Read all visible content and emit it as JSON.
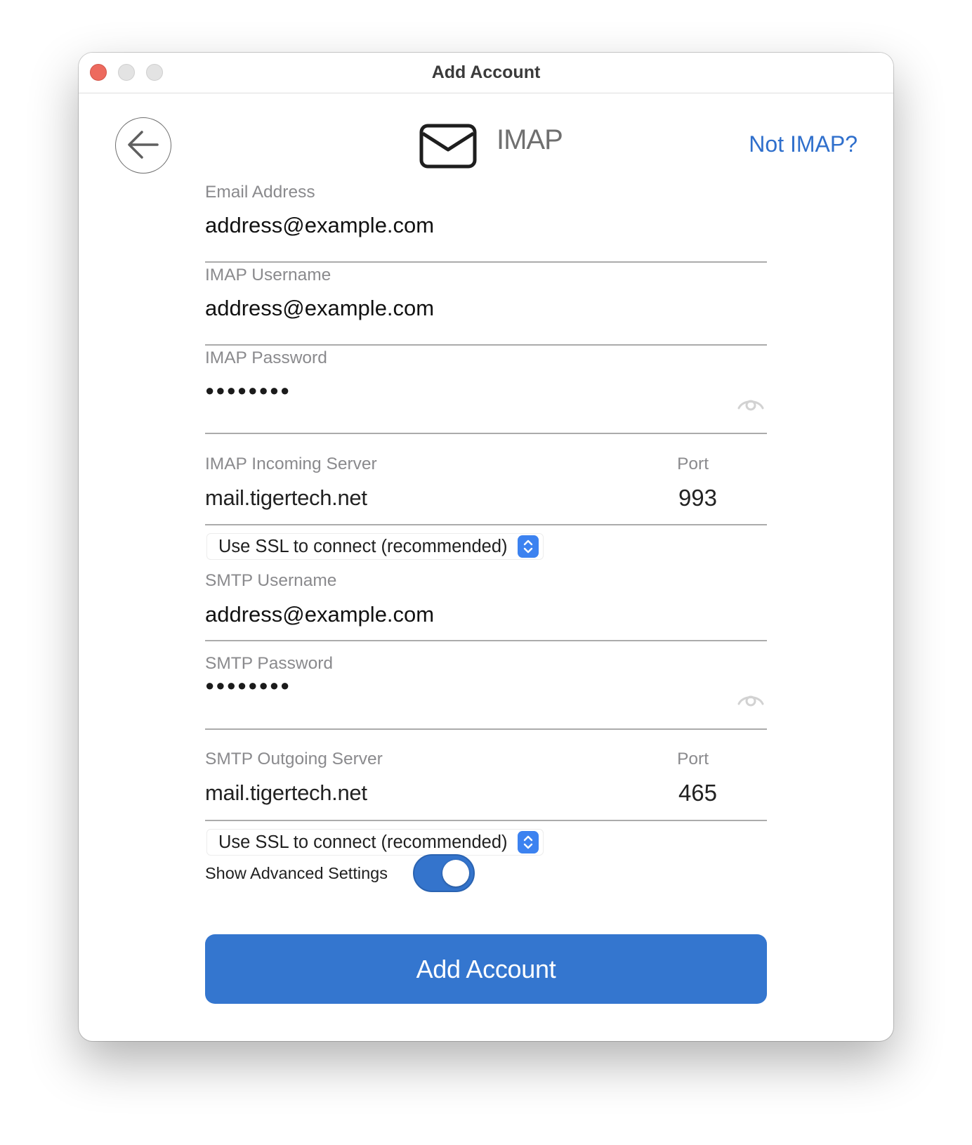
{
  "window": {
    "title": "Add Account",
    "controls": [
      "close",
      "minimize",
      "maximize"
    ]
  },
  "header": {
    "back_icon": "arrow-left-icon",
    "service_icon": "envelope-icon",
    "service_name": "IMAP",
    "switch_link": "Not IMAP?"
  },
  "form": {
    "email": {
      "label": "Email Address",
      "value": "address@example.com"
    },
    "imap_username": {
      "label": "IMAP Username",
      "value": "address@example.com"
    },
    "imap_password": {
      "label": "IMAP Password",
      "value": "●●●●●●●●",
      "reveal_icon": "eye-icon"
    },
    "imap_server": {
      "label": "IMAP Incoming Server",
      "value": "mail.tigertech.net",
      "port_label": "Port",
      "port_value": "993"
    },
    "imap_ssl": {
      "selected": "Use SSL to connect (recommended)",
      "icon": "up-down-chevron-icon"
    },
    "smtp_username": {
      "label": "SMTP Username",
      "value": "address@example.com"
    },
    "smtp_password": {
      "label": "SMTP Password",
      "value": "●●●●●●●●",
      "reveal_icon": "eye-icon"
    },
    "smtp_server": {
      "label": "SMTP Outgoing Server",
      "value": "mail.tigertech.net",
      "port_label": "Port",
      "port_value": "465"
    },
    "smtp_ssl": {
      "selected": "Use SSL to connect (recommended)",
      "icon": "up-down-chevron-icon"
    },
    "advanced": {
      "label": "Show Advanced Settings",
      "enabled": true
    }
  },
  "actions": {
    "submit_label": "Add Account"
  },
  "colors": {
    "accent": "#3476cf",
    "link": "#2f6fcc",
    "close_light": "#ed6a5e",
    "label_gray": "#8a8a8d"
  }
}
